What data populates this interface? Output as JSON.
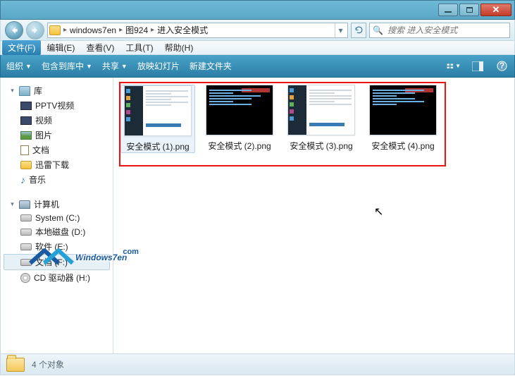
{
  "breadcrumb": {
    "seg1": "windows7en",
    "seg2": "图924",
    "seg3": "进入安全模式"
  },
  "search": {
    "placeholder": "搜索 进入安全模式"
  },
  "menu": {
    "file": "文件(F)",
    "edit": "编辑(E)",
    "view": "查看(V)",
    "tools": "工具(T)",
    "help": "帮助(H)"
  },
  "toolbar": {
    "organize": "组织",
    "include": "包含到库中",
    "share": "共享",
    "slideshow": "放映幻灯片",
    "newfolder": "新建文件夹"
  },
  "sidebar": {
    "libraries": "库",
    "pptv": "PPTV视频",
    "videos": "视频",
    "pictures": "图片",
    "documents": "文档",
    "downloads": "迅雷下载",
    "music": "音乐",
    "computer": "计算机",
    "system_c": "System (C:)",
    "local_d": "本地磁盘 (D:)",
    "soft_e": "软件 (E:)",
    "doc_f": "文档 (F:)",
    "cd_h": "CD 驱动器 (H:)"
  },
  "files": {
    "f1": "安全模式 (1).png",
    "f2": "安全模式 (2).png",
    "f3": "安全模式 (3).png",
    "f4": "安全模式 (4).png"
  },
  "status": {
    "count": "4 个对象"
  },
  "watermark": {
    "text": "indows7en",
    "com": "com"
  }
}
